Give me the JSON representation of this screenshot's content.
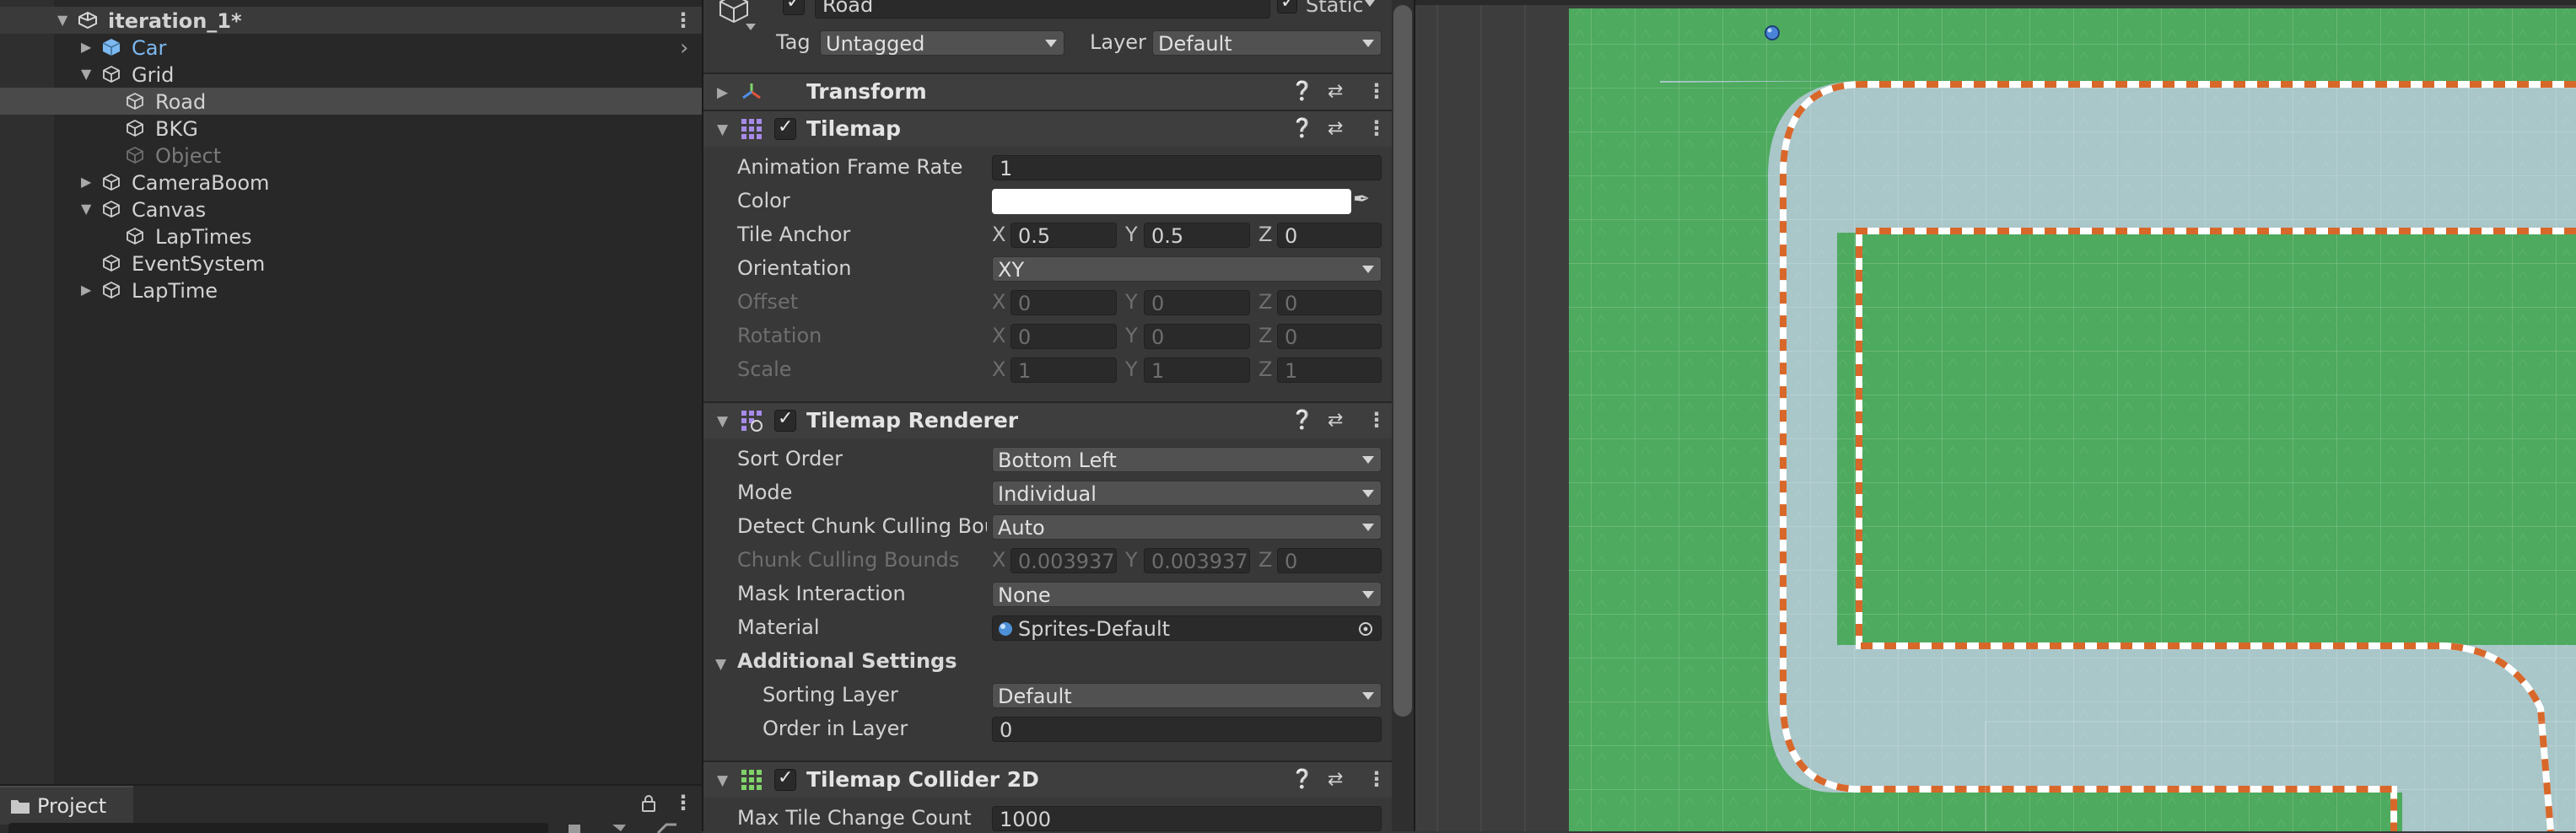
{
  "hierarchy": {
    "scene": "iteration_1*",
    "items": [
      {
        "label": "Car"
      },
      {
        "label": "Grid"
      },
      {
        "label": "Road"
      },
      {
        "label": "BKG"
      },
      {
        "label": "Object"
      },
      {
        "label": "CameraBoom"
      },
      {
        "label": "Canvas"
      },
      {
        "label": "LapTimes"
      },
      {
        "label": "EventSystem"
      },
      {
        "label": "LapTime"
      }
    ]
  },
  "project": {
    "tab_label": "Project"
  },
  "inspector": {
    "object_name": "Road",
    "static_label": "Static",
    "tag_label": "Tag",
    "tag_value": "Untagged",
    "layer_label": "Layer",
    "layer_value": "Default",
    "transform": {
      "title": "Transform"
    },
    "tilemap": {
      "title": "Tilemap",
      "animation_frame_rate_label": "Animation Frame Rate",
      "animation_frame_rate": "1",
      "color_label": "Color",
      "tile_anchor_label": "Tile Anchor",
      "tile_anchor": {
        "x": "0.5",
        "y": "0.5",
        "z": "0"
      },
      "orientation_label": "Orientation",
      "orientation": "XY",
      "offset_label": "Offset",
      "offset": {
        "x": "0",
        "y": "0",
        "z": "0"
      },
      "rotation_label": "Rotation",
      "rotation": {
        "x": "0",
        "y": "0",
        "z": "0"
      },
      "scale_label": "Scale",
      "scale": {
        "x": "1",
        "y": "1",
        "z": "1"
      }
    },
    "tilemap_renderer": {
      "title": "Tilemap Renderer",
      "sort_order_label": "Sort Order",
      "sort_order": "Bottom Left",
      "mode_label": "Mode",
      "mode": "Individual",
      "detect_chunk_label": "Detect Chunk Culling Bour",
      "detect_chunk": "Auto",
      "chunk_bounds_label": "Chunk Culling Bounds",
      "chunk_bounds": {
        "x": "0.003937",
        "y": "0.003937",
        "z": "0"
      },
      "mask_interaction_label": "Mask Interaction",
      "mask_interaction": "None",
      "material_label": "Material",
      "material": "Sprites-Default",
      "additional_settings_label": "Additional Settings",
      "sorting_layer_label": "Sorting Layer",
      "sorting_layer": "Default",
      "order_in_layer_label": "Order in Layer",
      "order_in_layer": "0"
    },
    "tilemap_collider": {
      "title": "Tilemap Collider 2D",
      "max_tile_change_label": "Max Tile Change Count",
      "max_tile_change": "1000"
    },
    "axis": {
      "x": "X",
      "y": "Y",
      "z": "Z"
    }
  },
  "colors": {
    "grass": "#4daa5e",
    "road": "#a9c6c9",
    "curb_red": "#d8672a",
    "curb_white": "#ffffff",
    "selection_blue": "#7cb9f0"
  }
}
